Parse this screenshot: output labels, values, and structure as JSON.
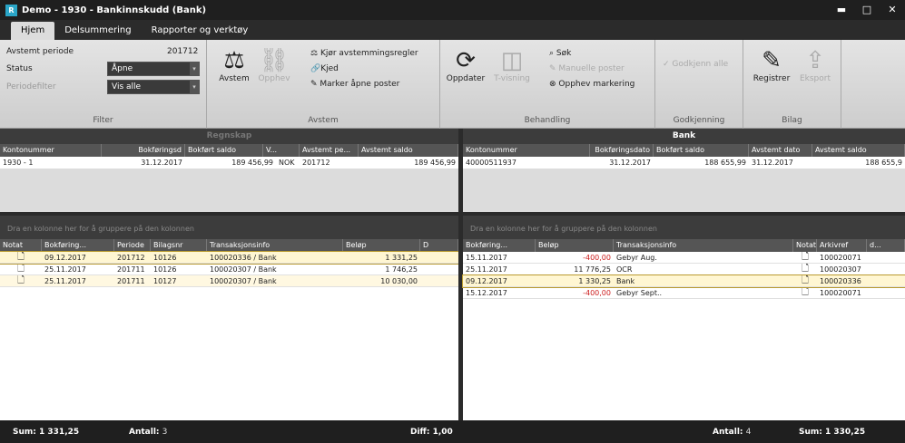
{
  "window": {
    "title": "Demo - 1930 - Bankinnskudd (Bank)",
    "app_icon": "R"
  },
  "tabs": [
    {
      "label": "Hjem",
      "active": true
    },
    {
      "label": "Delsummering"
    },
    {
      "label": "Rapporter og verktøy"
    }
  ],
  "ribbon": {
    "filter": {
      "label": "Filter",
      "avstemt_periode_label": "Avstemt periode",
      "avstemt_periode_value": "201712",
      "status_label": "Status",
      "status_value": "Åpne",
      "periodefilter_label": "Periodefilter",
      "periodefilter_value": "Vis alle"
    },
    "avstem": {
      "label": "Avstem",
      "avstem_btn": "Avstem",
      "opphev_btn": "Opphev",
      "kjor_btn": "Kjør avstemmingsregler",
      "kjed_btn": "Kjed",
      "marker_btn": "Marker åpne poster"
    },
    "behandling": {
      "label": "Behandling",
      "oppdater_btn": "Oppdater",
      "tvisning_btn": "T-visning",
      "sok_btn": "Søk",
      "manuelle_btn": "Manuelle poster",
      "opphev_markering_btn": "Opphev markering"
    },
    "godkjenning": {
      "label": "Godkjenning",
      "godkjenn_btn": "Godkjenn alle"
    },
    "bilag": {
      "label": "Bilag",
      "registrer_btn": "Registrer",
      "eksport_btn": "Eksport"
    }
  },
  "left": {
    "title": "Regnskap",
    "columns": [
      "Kontonummer",
      "Bokføringsd",
      "Bokført saldo",
      "V...",
      "Avstemt pe...",
      "Avstemt saldo"
    ],
    "rows": [
      [
        "1930 - 1",
        "31.12.2017",
        "189 456,99",
        "NOK",
        "201712",
        "189 456,99"
      ]
    ],
    "group_hint": "Dra en kolonne her for å gruppere på den kolonnen",
    "trans_columns": [
      "Notat",
      "Bokføring...",
      "Periode",
      "Bilagsnr",
      "Transaksjonsinfo",
      "Beløp",
      "D"
    ],
    "trans": [
      {
        "date": "09.12.2017",
        "periode": "201712",
        "bilag": "10126",
        "info": "100020336 / Bank",
        "belop": "1 331,25"
      },
      {
        "date": "25.11.2017",
        "periode": "201711",
        "bilag": "10126",
        "info": "100020307 / Bank",
        "belop": "1 746,25"
      },
      {
        "date": "25.11.2017",
        "periode": "201711",
        "bilag": "10127",
        "info": "100020307 / Bank",
        "belop": "10 030,00"
      }
    ]
  },
  "right": {
    "title": "Bank",
    "columns": [
      "Kontonummer",
      "Bokføringsdato",
      "Bokført saldo",
      "Avstemt dato",
      "Avstemt saldo"
    ],
    "rows": [
      [
        "40000511937",
        "31.12.2017",
        "188 655,99",
        "31.12.2017",
        "188 655,9"
      ]
    ],
    "group_hint": "Dra en kolonne her for å gruppere på den kolonnen",
    "trans_columns": [
      "Bokføring...",
      "Beløp",
      "Transaksjonsinfo",
      "Notat",
      "Arkivref",
      "d..."
    ],
    "trans": [
      {
        "date": "15.11.2017",
        "belop": "-400,00",
        "info": "Gebyr Aug.",
        "ark": "100020071",
        "neg": true
      },
      {
        "date": "25.11.2017",
        "belop": "11 776,25",
        "info": "OCR",
        "ark": "100020307",
        "neg": false
      },
      {
        "date": "09.12.2017",
        "belop": "1 330,25",
        "info": "Bank",
        "ark": "100020336",
        "neg": false
      },
      {
        "date": "15.12.2017",
        "belop": "-400,00",
        "info": "Gebyr Sept..",
        "ark": "100020071",
        "neg": true
      }
    ]
  },
  "footer": {
    "sum_left_label": "Sum:",
    "sum_left": "1 331,25",
    "antall_left_label": "Antall:",
    "antall_left": "3",
    "diff_label": "Diff:",
    "diff": "1,00",
    "antall_right_label": "Antall:",
    "antall_right": "4",
    "sum_right_label": "Sum:",
    "sum_right": "1 330,25"
  }
}
